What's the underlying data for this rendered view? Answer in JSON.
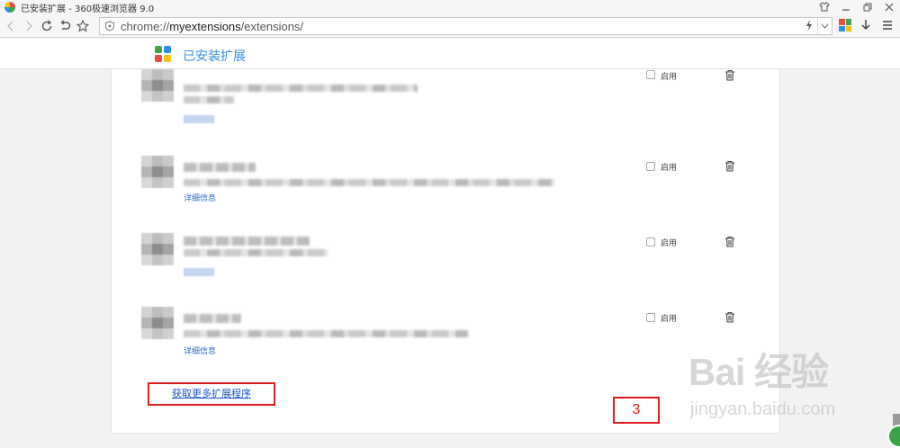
{
  "window": {
    "title": "已安装扩展 - 360极速浏览器 9.0",
    "controls": [
      "shirt-icon",
      "minimize-icon",
      "restore-icon",
      "close-icon"
    ]
  },
  "toolbar": {
    "url_prefix": "chrome://",
    "url_host": "myextensions",
    "url_path": "/extensions/",
    "icons": [
      "back-icon",
      "forward-icon",
      "reload-icon",
      "undo-icon",
      "star-icon",
      "shield-icon",
      "bolt-icon",
      "apps-icon",
      "download-icon",
      "menu-icon"
    ]
  },
  "page": {
    "title": "已安装扩展"
  },
  "extensions": [
    {
      "detail_label": "",
      "enable_label": "启用",
      "enabled": false
    },
    {
      "detail_label": "详细信息",
      "enable_label": "启用",
      "enabled": false
    },
    {
      "detail_label": "",
      "enable_label": "启用",
      "enabled": false
    },
    {
      "detail_label": "详细信息",
      "enable_label": "启用",
      "enabled": false
    }
  ],
  "more_link": "获取更多扩展程序",
  "step_marker": "3",
  "watermark": {
    "main": "Bai 经验",
    "sub": "jingyan.baidu.com"
  },
  "colors": {
    "accent": "#3a8ee6",
    "link": "#1b56c7",
    "annotation": "#e11d1d"
  }
}
